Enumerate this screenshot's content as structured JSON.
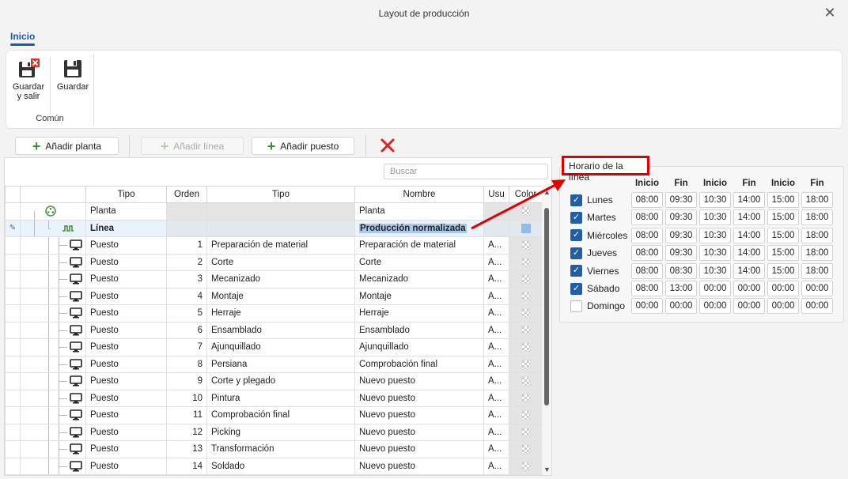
{
  "window": {
    "title": "Layout de producción",
    "close_icon": "✕"
  },
  "ribbon": {
    "tab": "Inicio",
    "buttons": [
      {
        "label_line1": "Guardar",
        "label_line2": "y salir"
      },
      {
        "label_line1": "Guardar",
        "label_line2": ""
      }
    ],
    "group_label": "Común"
  },
  "toolbar": {
    "add_plant": "Añadir planta",
    "add_line": "Añadir línea",
    "add_station": "Añadir puesto"
  },
  "grid": {
    "search_placeholder": "Buscar",
    "columns": [
      "Tipo",
      "Orden",
      "Tipo",
      "Nombre",
      "Usu",
      "Color"
    ],
    "plant_row": {
      "tipo": "Planta",
      "nombre": "Planta"
    },
    "line_row": {
      "tipo": "Línea",
      "nombre": "Producción normalizada"
    },
    "rows": [
      {
        "tipo": "Puesto",
        "orden": "1",
        "tipo2": "Preparación de material",
        "nombre": "Preparación de material",
        "usu": "A..."
      },
      {
        "tipo": "Puesto",
        "orden": "2",
        "tipo2": "Corte",
        "nombre": "Corte",
        "usu": "A..."
      },
      {
        "tipo": "Puesto",
        "orden": "3",
        "tipo2": "Mecanizado",
        "nombre": "Mecanizado",
        "usu": "A..."
      },
      {
        "tipo": "Puesto",
        "orden": "4",
        "tipo2": "Montaje",
        "nombre": "Montaje",
        "usu": "A..."
      },
      {
        "tipo": "Puesto",
        "orden": "5",
        "tipo2": "Herraje",
        "nombre": "Herraje",
        "usu": "A..."
      },
      {
        "tipo": "Puesto",
        "orden": "6",
        "tipo2": "Ensamblado",
        "nombre": "Ensamblado",
        "usu": "A..."
      },
      {
        "tipo": "Puesto",
        "orden": "7",
        "tipo2": "Ajunquillado",
        "nombre": "Ajunquillado",
        "usu": "A..."
      },
      {
        "tipo": "Puesto",
        "orden": "8",
        "tipo2": "Persiana",
        "nombre": "Comprobación final",
        "usu": "A..."
      },
      {
        "tipo": "Puesto",
        "orden": "9",
        "tipo2": "Corte y plegado",
        "nombre": "Nuevo puesto",
        "usu": "A..."
      },
      {
        "tipo": "Puesto",
        "orden": "10",
        "tipo2": "Pintura",
        "nombre": "Nuevo puesto",
        "usu": "A..."
      },
      {
        "tipo": "Puesto",
        "orden": "11",
        "tipo2": "Comprobación final",
        "nombre": "Nuevo puesto",
        "usu": "A..."
      },
      {
        "tipo": "Puesto",
        "orden": "12",
        "tipo2": "Picking",
        "nombre": "Nuevo puesto",
        "usu": "A..."
      },
      {
        "tipo": "Puesto",
        "orden": "13",
        "tipo2": "Transformación",
        "nombre": "Nuevo puesto",
        "usu": "A..."
      },
      {
        "tipo": "Puesto",
        "orden": "14",
        "tipo2": "Soldado",
        "nombre": "Nuevo puesto",
        "usu": "A..."
      }
    ]
  },
  "schedule": {
    "tag": "Horario de la línea",
    "headers": [
      "Inicio",
      "Fin",
      "Inicio",
      "Fin",
      "Inicio",
      "Fin"
    ],
    "days": [
      {
        "name": "Lunes",
        "checked": true,
        "times": [
          "08:00",
          "09:30",
          "10:30",
          "14:00",
          "15:00",
          "18:00"
        ]
      },
      {
        "name": "Martes",
        "checked": true,
        "times": [
          "08:00",
          "09:30",
          "10:30",
          "14:00",
          "15:00",
          "18:00"
        ]
      },
      {
        "name": "Miércoles",
        "checked": true,
        "times": [
          "08:00",
          "09:30",
          "10:30",
          "14:00",
          "15:00",
          "18:00"
        ]
      },
      {
        "name": "Jueves",
        "checked": true,
        "times": [
          "08:00",
          "09:30",
          "10:30",
          "14:00",
          "15:00",
          "18:00"
        ]
      },
      {
        "name": "Viernes",
        "checked": true,
        "times": [
          "08:00",
          "08:30",
          "10:30",
          "14:00",
          "15:00",
          "18:00"
        ]
      },
      {
        "name": "Sábado",
        "checked": true,
        "times": [
          "08:00",
          "13:00",
          "00:00",
          "00:00",
          "00:00",
          "00:00"
        ]
      },
      {
        "name": "Domingo",
        "checked": false,
        "times": [
          "00:00",
          "00:00",
          "00:00",
          "00:00",
          "00:00",
          "00:00"
        ]
      }
    ]
  },
  "colors": {
    "accent": "#1a5ca8",
    "annotation": "#e00000",
    "selection": "#eaf3fc",
    "highlight": "#a9c9ec"
  }
}
